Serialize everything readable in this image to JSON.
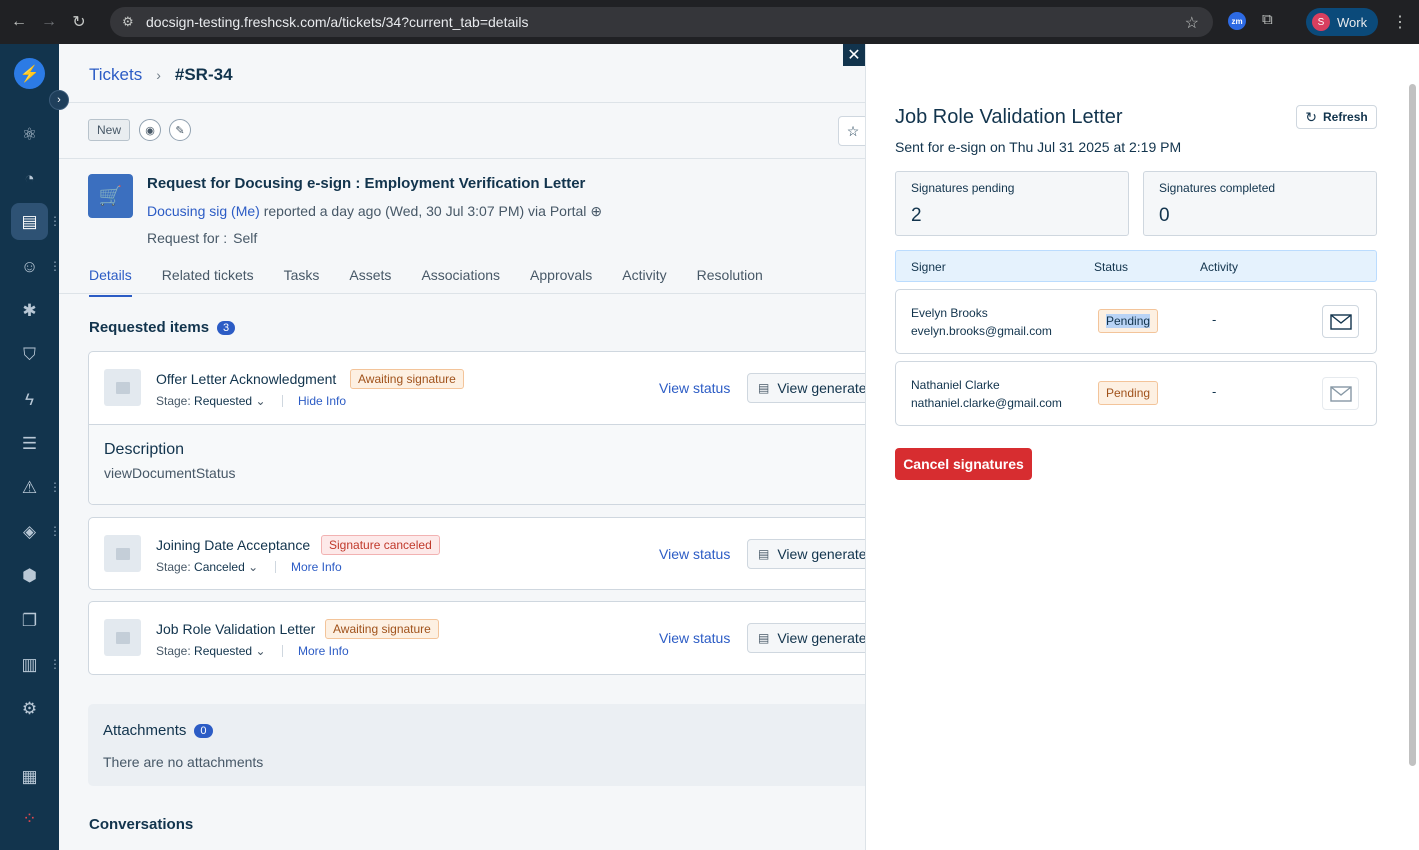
{
  "browser": {
    "url": "docsign-testing.freshcsk.com/a/tickets/34?current_tab=details",
    "ext_zm": "zm",
    "profile_initial": "S",
    "profile_name": "Work"
  },
  "header": {
    "breadcrumb_link": "Tickets",
    "breadcrumb_id": "#SR-34",
    "status": "New"
  },
  "ticket": {
    "title": "Request for Docusing e-sign : Employment Verification Letter",
    "requester": "Docusing sig (Me)",
    "meta": " reported a day ago (Wed, 30 Jul 3:07 PM) via Portal ",
    "request_for_label": "Request for :",
    "request_for_value": "Self"
  },
  "tabs": [
    "Details",
    "Related tickets",
    "Tasks",
    "Assets",
    "Associations",
    "Approvals",
    "Activity",
    "Resolution"
  ],
  "requested_items": {
    "title": "Requested items",
    "count": "3",
    "items": [
      {
        "name": "Offer Letter Acknowledgment",
        "status": "Awaiting signature",
        "stage_label": "Stage:",
        "stage": "Requested",
        "info_link": "Hide Info",
        "view_status": "View status",
        "view_generated": "View generated document",
        "description_label": "Description",
        "description": "viewDocumentStatus"
      },
      {
        "name": "Joining Date Acceptance",
        "status": "Signature canceled",
        "stage_label": "Stage:",
        "stage": "Canceled",
        "info_link": "More Info",
        "view_status": "View status",
        "view_generated": "View generated document"
      },
      {
        "name": "Job Role Validation Letter",
        "status": "Awaiting signature",
        "stage_label": "Stage:",
        "stage": "Requested",
        "info_link": "More Info",
        "view_status": "View status",
        "view_generated": "View generated document"
      }
    ]
  },
  "attachments": {
    "title": "Attachments",
    "count": "0",
    "empty_text": "There are no attachments"
  },
  "conversations_title": "Conversations",
  "panel": {
    "title": "Job Role Validation Letter",
    "subtitle": "Sent for e-sign on Thu Jul 31 2025 at 2:19 PM",
    "refresh_label": "Refresh",
    "pending_label": "Signatures pending",
    "pending_value": "2",
    "completed_label": "Signatures completed",
    "completed_value": "0",
    "columns": {
      "signer": "Signer",
      "status": "Status",
      "activity": "Activity"
    },
    "signers": [
      {
        "name": "Evelyn Brooks",
        "email": "evelyn.brooks@gmail.com",
        "status": "Pending",
        "activity": "-"
      },
      {
        "name": "Nathaniel Clarke",
        "email": "nathaniel.clarke@gmail.com",
        "status": "Pending",
        "activity": "-"
      }
    ],
    "cancel_label": "Cancel signatures"
  },
  "colors": {
    "nav_bg": "#12344d",
    "link": "#2c5cc5",
    "danger": "#d72d30",
    "pending_bg": "#fdf0e2"
  }
}
